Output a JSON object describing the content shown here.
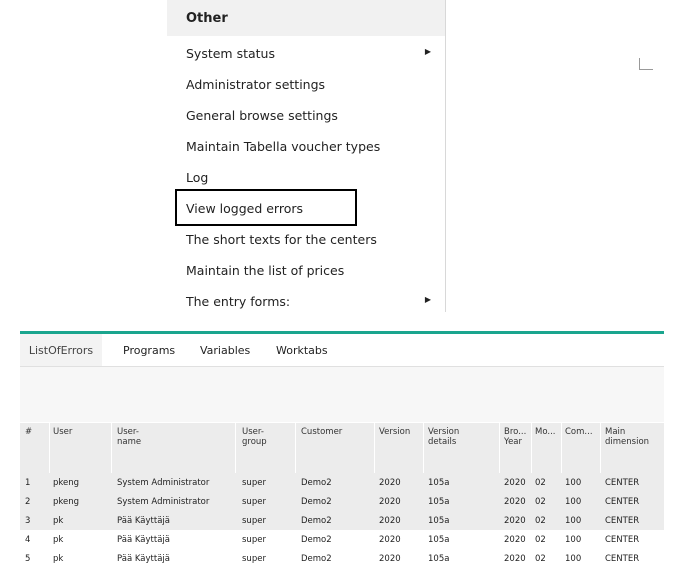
{
  "menu": {
    "header": "Other",
    "items": [
      {
        "label": "System status",
        "submenu": true
      },
      {
        "label": "Administrator settings",
        "submenu": false
      },
      {
        "label": "General browse settings",
        "submenu": false
      },
      {
        "label": "Maintain Tabella voucher types",
        "submenu": false
      },
      {
        "label": "Log",
        "submenu": false
      },
      {
        "label": "View logged errors",
        "submenu": false,
        "highlighted": true
      },
      {
        "label": "The short texts for the centers",
        "submenu": false
      },
      {
        "label": "Maintain the list of prices",
        "submenu": false
      },
      {
        "label": "The entry forms:",
        "submenu": true
      }
    ]
  },
  "arrow_glyph": "▶",
  "accent_color": "#1aa58e",
  "tabs": [
    {
      "label": "ListOfErrors",
      "active": true
    },
    {
      "label": "Programs",
      "active": false
    },
    {
      "label": "Variables",
      "active": false
    },
    {
      "label": "Worktabs",
      "active": false
    }
  ],
  "columns": [
    "#",
    "User",
    "User-\nname",
    "User-\ngroup",
    "Customer",
    "Version",
    "Version\ndetails",
    "Bro...\nYear",
    "Mo...",
    "Com...",
    "Main\ndimension"
  ],
  "rows": [
    [
      "1",
      "pkeng",
      "System Administrator",
      "super",
      "Demo2",
      "2020",
      "105a",
      "2020",
      "02",
      "100",
      "CENTER"
    ],
    [
      "2",
      "pkeng",
      "System Administrator",
      "super",
      "Demo2",
      "2020",
      "105a",
      "2020",
      "02",
      "100",
      "CENTER"
    ],
    [
      "3",
      "pk",
      "Pää Käyttäjä",
      "super",
      "Demo2",
      "2020",
      "105a",
      "2020",
      "02",
      "100",
      "CENTER"
    ],
    [
      "4",
      "pk",
      "Pää Käyttäjä",
      "super",
      "Demo2",
      "2020",
      "105a",
      "2020",
      "02",
      "100",
      "CENTER"
    ],
    [
      "5",
      "pk",
      "Pää Käyttäjä",
      "super",
      "Demo2",
      "2020",
      "105a",
      "2020",
      "02",
      "100",
      "CENTER"
    ]
  ],
  "alt_rows": [
    0,
    1,
    2
  ]
}
